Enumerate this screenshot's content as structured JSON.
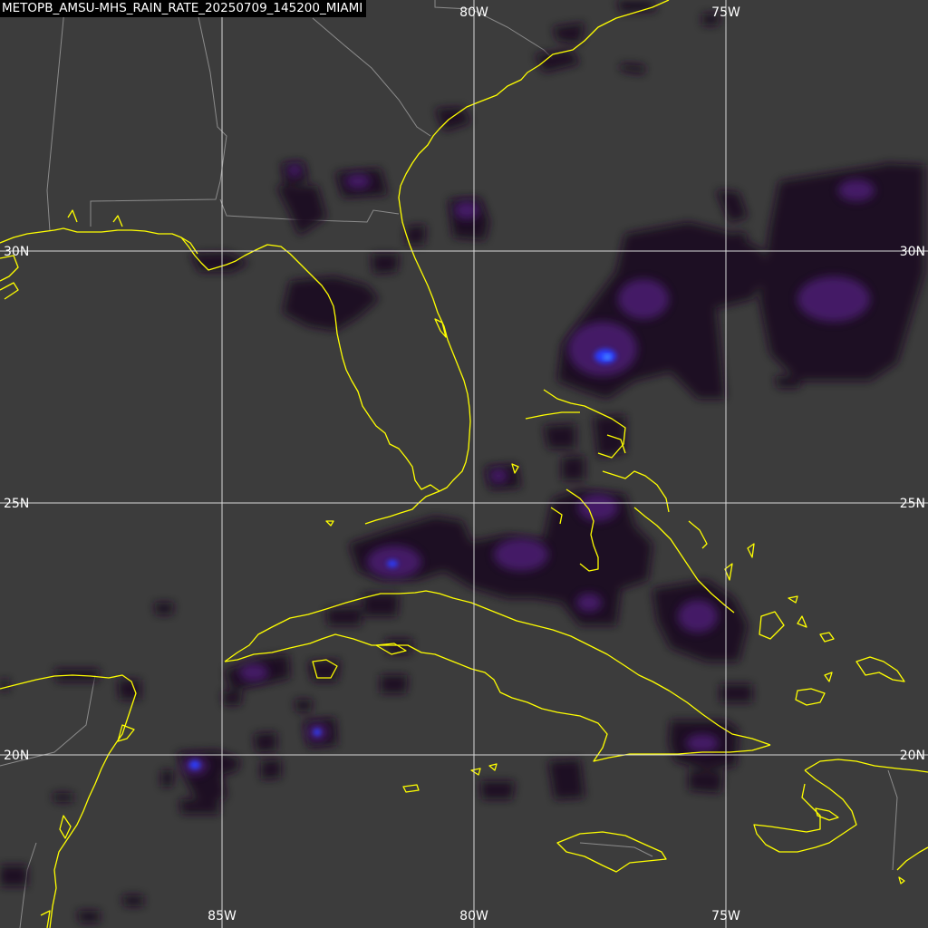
{
  "title": "METOPB_AMSU-MHS_RAIN_RATE_20250709_145200_MIAMI",
  "colors": {
    "background": "#3c3c3c",
    "grid": "#d8d8d8",
    "coastline": "#ffff00",
    "borders": "#8c8c8c",
    "rain_light": "#2a0a2e",
    "rain_moderate": "#5a1f8a",
    "rain_heavy": "#2a3cff"
  },
  "longitude_labels_top": [
    "80W",
    "75W"
  ],
  "longitude_labels_bottom": [
    "85W",
    "80W",
    "75W"
  ],
  "latitude_labels_left": [
    "30N",
    "25N",
    "20N"
  ],
  "latitude_labels_right": [
    "30N",
    "25N",
    "20N"
  ]
}
